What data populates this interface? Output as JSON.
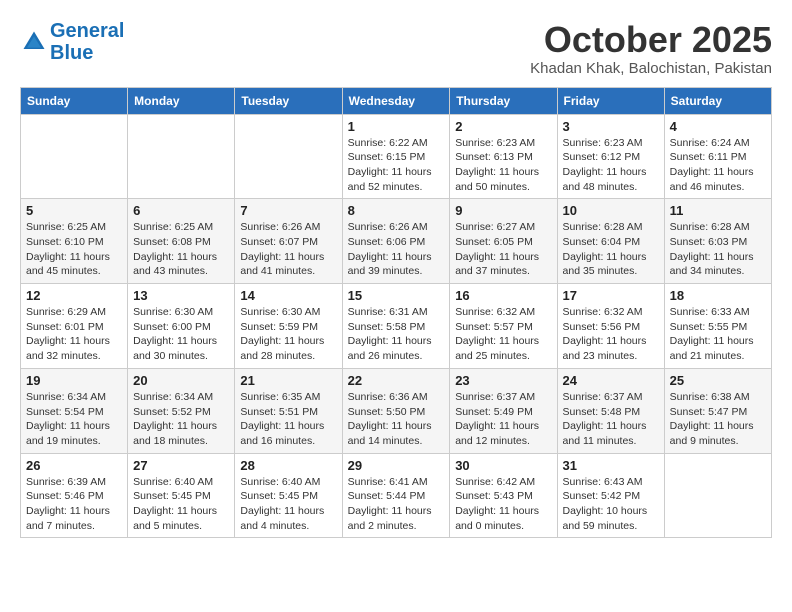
{
  "header": {
    "logo_line1": "General",
    "logo_line2": "Blue",
    "month": "October 2025",
    "location": "Khadan Khak, Balochistan, Pakistan"
  },
  "weekdays": [
    "Sunday",
    "Monday",
    "Tuesday",
    "Wednesday",
    "Thursday",
    "Friday",
    "Saturday"
  ],
  "weeks": [
    [
      {
        "day": "",
        "sunrise": "",
        "sunset": "",
        "daylight": ""
      },
      {
        "day": "",
        "sunrise": "",
        "sunset": "",
        "daylight": ""
      },
      {
        "day": "",
        "sunrise": "",
        "sunset": "",
        "daylight": ""
      },
      {
        "day": "1",
        "sunrise": "Sunrise: 6:22 AM",
        "sunset": "Sunset: 6:15 PM",
        "daylight": "Daylight: 11 hours and 52 minutes."
      },
      {
        "day": "2",
        "sunrise": "Sunrise: 6:23 AM",
        "sunset": "Sunset: 6:13 PM",
        "daylight": "Daylight: 11 hours and 50 minutes."
      },
      {
        "day": "3",
        "sunrise": "Sunrise: 6:23 AM",
        "sunset": "Sunset: 6:12 PM",
        "daylight": "Daylight: 11 hours and 48 minutes."
      },
      {
        "day": "4",
        "sunrise": "Sunrise: 6:24 AM",
        "sunset": "Sunset: 6:11 PM",
        "daylight": "Daylight: 11 hours and 46 minutes."
      }
    ],
    [
      {
        "day": "5",
        "sunrise": "Sunrise: 6:25 AM",
        "sunset": "Sunset: 6:10 PM",
        "daylight": "Daylight: 11 hours and 45 minutes."
      },
      {
        "day": "6",
        "sunrise": "Sunrise: 6:25 AM",
        "sunset": "Sunset: 6:08 PM",
        "daylight": "Daylight: 11 hours and 43 minutes."
      },
      {
        "day": "7",
        "sunrise": "Sunrise: 6:26 AM",
        "sunset": "Sunset: 6:07 PM",
        "daylight": "Daylight: 11 hours and 41 minutes."
      },
      {
        "day": "8",
        "sunrise": "Sunrise: 6:26 AM",
        "sunset": "Sunset: 6:06 PM",
        "daylight": "Daylight: 11 hours and 39 minutes."
      },
      {
        "day": "9",
        "sunrise": "Sunrise: 6:27 AM",
        "sunset": "Sunset: 6:05 PM",
        "daylight": "Daylight: 11 hours and 37 minutes."
      },
      {
        "day": "10",
        "sunrise": "Sunrise: 6:28 AM",
        "sunset": "Sunset: 6:04 PM",
        "daylight": "Daylight: 11 hours and 35 minutes."
      },
      {
        "day": "11",
        "sunrise": "Sunrise: 6:28 AM",
        "sunset": "Sunset: 6:03 PM",
        "daylight": "Daylight: 11 hours and 34 minutes."
      }
    ],
    [
      {
        "day": "12",
        "sunrise": "Sunrise: 6:29 AM",
        "sunset": "Sunset: 6:01 PM",
        "daylight": "Daylight: 11 hours and 32 minutes."
      },
      {
        "day": "13",
        "sunrise": "Sunrise: 6:30 AM",
        "sunset": "Sunset: 6:00 PM",
        "daylight": "Daylight: 11 hours and 30 minutes."
      },
      {
        "day": "14",
        "sunrise": "Sunrise: 6:30 AM",
        "sunset": "Sunset: 5:59 PM",
        "daylight": "Daylight: 11 hours and 28 minutes."
      },
      {
        "day": "15",
        "sunrise": "Sunrise: 6:31 AM",
        "sunset": "Sunset: 5:58 PM",
        "daylight": "Daylight: 11 hours and 26 minutes."
      },
      {
        "day": "16",
        "sunrise": "Sunrise: 6:32 AM",
        "sunset": "Sunset: 5:57 PM",
        "daylight": "Daylight: 11 hours and 25 minutes."
      },
      {
        "day": "17",
        "sunrise": "Sunrise: 6:32 AM",
        "sunset": "Sunset: 5:56 PM",
        "daylight": "Daylight: 11 hours and 23 minutes."
      },
      {
        "day": "18",
        "sunrise": "Sunrise: 6:33 AM",
        "sunset": "Sunset: 5:55 PM",
        "daylight": "Daylight: 11 hours and 21 minutes."
      }
    ],
    [
      {
        "day": "19",
        "sunrise": "Sunrise: 6:34 AM",
        "sunset": "Sunset: 5:54 PM",
        "daylight": "Daylight: 11 hours and 19 minutes."
      },
      {
        "day": "20",
        "sunrise": "Sunrise: 6:34 AM",
        "sunset": "Sunset: 5:52 PM",
        "daylight": "Daylight: 11 hours and 18 minutes."
      },
      {
        "day": "21",
        "sunrise": "Sunrise: 6:35 AM",
        "sunset": "Sunset: 5:51 PM",
        "daylight": "Daylight: 11 hours and 16 minutes."
      },
      {
        "day": "22",
        "sunrise": "Sunrise: 6:36 AM",
        "sunset": "Sunset: 5:50 PM",
        "daylight": "Daylight: 11 hours and 14 minutes."
      },
      {
        "day": "23",
        "sunrise": "Sunrise: 6:37 AM",
        "sunset": "Sunset: 5:49 PM",
        "daylight": "Daylight: 11 hours and 12 minutes."
      },
      {
        "day": "24",
        "sunrise": "Sunrise: 6:37 AM",
        "sunset": "Sunset: 5:48 PM",
        "daylight": "Daylight: 11 hours and 11 minutes."
      },
      {
        "day": "25",
        "sunrise": "Sunrise: 6:38 AM",
        "sunset": "Sunset: 5:47 PM",
        "daylight": "Daylight: 11 hours and 9 minutes."
      }
    ],
    [
      {
        "day": "26",
        "sunrise": "Sunrise: 6:39 AM",
        "sunset": "Sunset: 5:46 PM",
        "daylight": "Daylight: 11 hours and 7 minutes."
      },
      {
        "day": "27",
        "sunrise": "Sunrise: 6:40 AM",
        "sunset": "Sunset: 5:45 PM",
        "daylight": "Daylight: 11 hours and 5 minutes."
      },
      {
        "day": "28",
        "sunrise": "Sunrise: 6:40 AM",
        "sunset": "Sunset: 5:45 PM",
        "daylight": "Daylight: 11 hours and 4 minutes."
      },
      {
        "day": "29",
        "sunrise": "Sunrise: 6:41 AM",
        "sunset": "Sunset: 5:44 PM",
        "daylight": "Daylight: 11 hours and 2 minutes."
      },
      {
        "day": "30",
        "sunrise": "Sunrise: 6:42 AM",
        "sunset": "Sunset: 5:43 PM",
        "daylight": "Daylight: 11 hours and 0 minutes."
      },
      {
        "day": "31",
        "sunrise": "Sunrise: 6:43 AM",
        "sunset": "Sunset: 5:42 PM",
        "daylight": "Daylight: 10 hours and 59 minutes."
      },
      {
        "day": "",
        "sunrise": "",
        "sunset": "",
        "daylight": ""
      }
    ]
  ]
}
